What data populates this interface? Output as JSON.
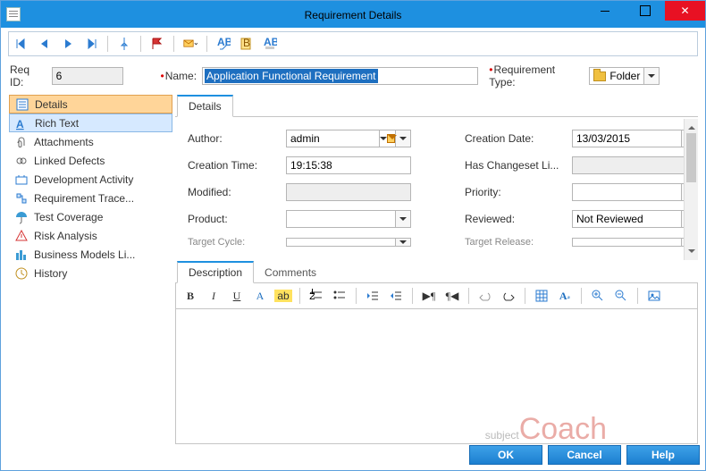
{
  "window": {
    "title": "Requirement Details"
  },
  "header": {
    "req_id_label": "Req ID:",
    "req_id_value": "6",
    "name_label": "Name:",
    "name_value": "Application Functional Requirement",
    "type_label": "Requirement Type:",
    "type_value": "Folder"
  },
  "sidebar": {
    "items": [
      {
        "label": "Details"
      },
      {
        "label": "Rich Text"
      },
      {
        "label": "Attachments"
      },
      {
        "label": "Linked Defects"
      },
      {
        "label": "Development Activity"
      },
      {
        "label": "Requirement Trace..."
      },
      {
        "label": "Test Coverage"
      },
      {
        "label": "Risk Analysis"
      },
      {
        "label": "Business Models Li..."
      },
      {
        "label": "History"
      }
    ]
  },
  "tabs": {
    "details": "Details"
  },
  "form": {
    "author_label": "Author:",
    "author_value": "admin",
    "creation_date_label": "Creation Date:",
    "creation_date_value": "13/03/2015",
    "creation_time_label": "Creation Time:",
    "creation_time_value": "19:15:38",
    "has_changeset_label": "Has Changeset Li...",
    "modified_label": "Modified:",
    "priority_label": "Priority:",
    "product_label": "Product:",
    "reviewed_label": "Reviewed:",
    "reviewed_value": "Not Reviewed",
    "target_cycle_label": "Target Cycle:",
    "target_release_label": "Target Release:"
  },
  "lower_tabs": {
    "description": "Description",
    "comments": "Comments"
  },
  "buttons": {
    "ok": "OK",
    "cancel": "Cancel",
    "help": "Help"
  },
  "watermark": {
    "a": "subject",
    "b": "Coach"
  }
}
